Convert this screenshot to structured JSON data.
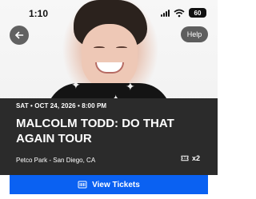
{
  "status_bar": {
    "time": "1:10",
    "battery": "60"
  },
  "header": {
    "help_label": "Help"
  },
  "event": {
    "date_line": "SAT • OCT 24, 2026 • 8:00 PM",
    "title": "MALCOLM TODD: DO THAT AGAIN TOUR",
    "venue": "Petco Park - San Diego, CA",
    "ticket_count": "x2"
  },
  "actions": {
    "view_tickets_label": "View Tickets"
  },
  "icons": {
    "back": "arrow-left-icon",
    "tickets": "ticket-icon",
    "view_tickets": "barcode-ticket-icon",
    "signal": "signal-icon",
    "wifi": "wifi-icon",
    "battery": "battery-icon"
  },
  "colors": {
    "primary_blue": "#0a61f2",
    "card_background": "#2b2b2b"
  }
}
